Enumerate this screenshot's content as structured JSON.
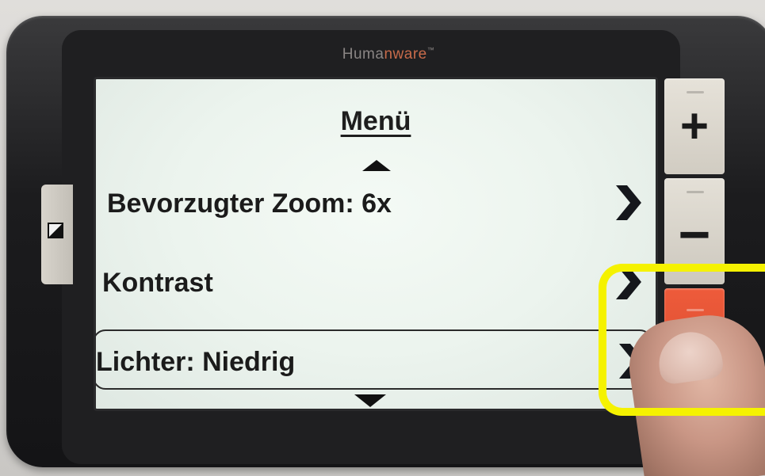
{
  "device": {
    "brand_prefix": "Huma",
    "brand_accent": "n",
    "brand_suffix": "ware",
    "brand_tm": "™",
    "brand_color": "#8a8584",
    "brand_accent_color": "#c86b4a"
  },
  "screen": {
    "title": "Menü",
    "scroll_up_icon": "triangle-up",
    "scroll_down_icon": "triangle-down",
    "menu_items": [
      {
        "label": "Bevorzugter Zoom: 6x",
        "selected": false
      },
      {
        "label": "Kontrast",
        "selected": false
      },
      {
        "label": "Lichter: Niedrig",
        "selected": true
      }
    ],
    "chevron_icon": "chevron-right"
  },
  "hardware_keys": {
    "zoom_in_symbol": "+",
    "zoom_out_symbol": "−",
    "contrast_icon": "half-filled-square",
    "select_button_color": "#e4533a"
  },
  "annotation": {
    "highlight_color": "#f5f200"
  }
}
